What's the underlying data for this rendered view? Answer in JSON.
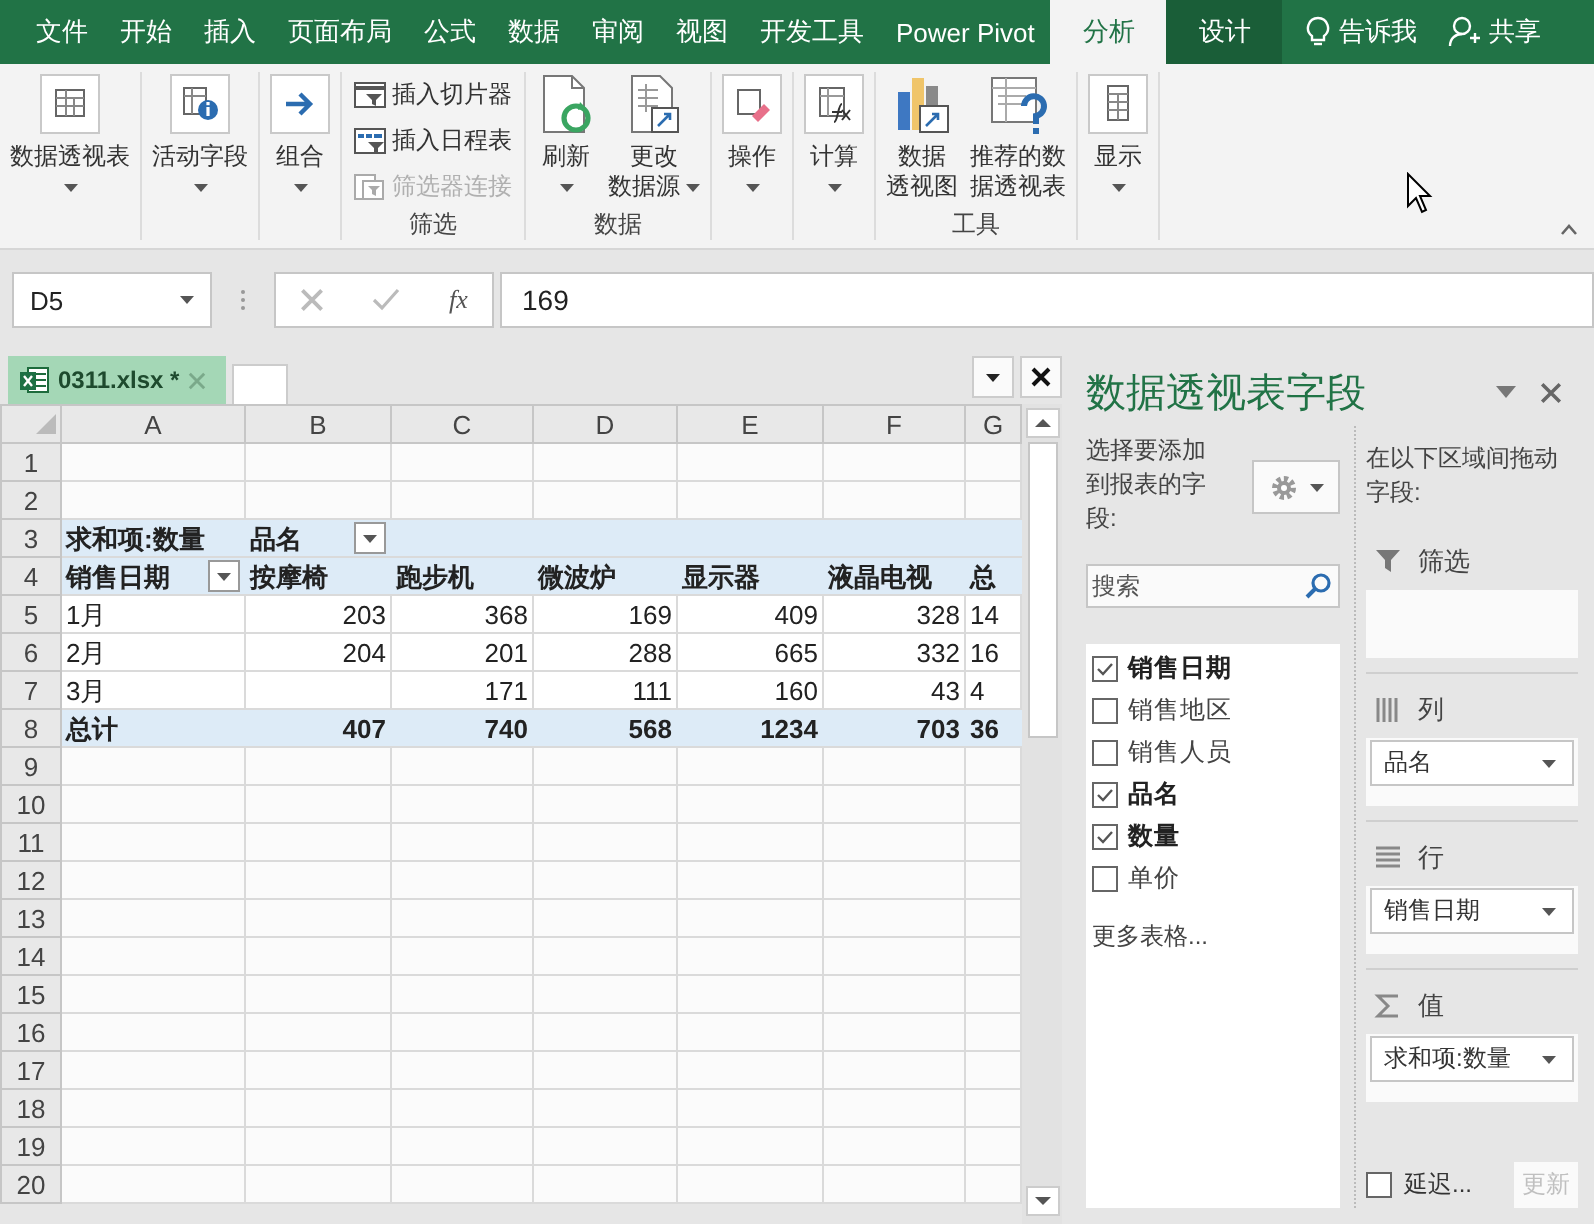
{
  "ribbon_tabs": [
    {
      "label": "文件",
      "selected": false,
      "kind": "normal"
    },
    {
      "label": "开始",
      "selected": false,
      "kind": "normal"
    },
    {
      "label": "插入",
      "selected": false,
      "kind": "normal"
    },
    {
      "label": "页面布局",
      "selected": false,
      "kind": "normal"
    },
    {
      "label": "公式",
      "selected": false,
      "kind": "normal"
    },
    {
      "label": "数据",
      "selected": false,
      "kind": "normal"
    },
    {
      "label": "审阅",
      "selected": false,
      "kind": "normal"
    },
    {
      "label": "视图",
      "selected": false,
      "kind": "normal"
    },
    {
      "label": "开发工具",
      "selected": false,
      "kind": "normal"
    },
    {
      "label": "Power Pivot",
      "selected": false,
      "kind": "normal"
    },
    {
      "label": "分析",
      "selected": true,
      "kind": "contextual"
    },
    {
      "label": "设计",
      "selected": false,
      "kind": "contextual"
    }
  ],
  "tell_me": "告诉我",
  "share": "共享",
  "ribbon_groups": [
    {
      "buttons": [
        {
          "label_lines": [
            "数据透视表"
          ],
          "kind": "large",
          "dropdown": true,
          "disabled": false
        }
      ]
    },
    {
      "buttons": [
        {
          "label_lines": [
            "活动字段"
          ],
          "kind": "large",
          "dropdown": true,
          "disabled": false
        }
      ]
    },
    {
      "buttons": [
        {
          "label_lines": [
            "组合"
          ],
          "kind": "large",
          "dropdown": true,
          "disabled": false
        }
      ]
    },
    {
      "label": "筛选",
      "buttons": [
        {
          "label_lines": [
            "插入切片器"
          ],
          "kind": "small",
          "dropdown": false,
          "disabled": false
        },
        {
          "label_lines": [
            "插入日程表"
          ],
          "kind": "small",
          "dropdown": false,
          "disabled": false
        },
        {
          "label_lines": [
            "筛选器连接"
          ],
          "kind": "small",
          "dropdown": false,
          "disabled": true
        }
      ]
    },
    {
      "label": "数据",
      "buttons": [
        {
          "label_lines": [
            "刷新"
          ],
          "kind": "large",
          "dropdown": true,
          "disabled": false
        },
        {
          "label_lines": [
            "更改",
            "数据源"
          ],
          "kind": "large",
          "dropdown": true,
          "disabled": false
        }
      ]
    },
    {
      "buttons": [
        {
          "label_lines": [
            "操作"
          ],
          "kind": "large",
          "dropdown": true,
          "disabled": false
        }
      ]
    },
    {
      "buttons": [
        {
          "label_lines": [
            "计算"
          ],
          "kind": "large",
          "dropdown": true,
          "disabled": false
        }
      ]
    },
    {
      "label": "工具",
      "buttons": [
        {
          "label_lines": [
            "数据",
            "透视图"
          ],
          "kind": "large",
          "dropdown": false,
          "disabled": false
        },
        {
          "label_lines": [
            "推荐的数",
            "据透视表"
          ],
          "kind": "large",
          "dropdown": false,
          "disabled": false
        }
      ]
    },
    {
      "buttons": [
        {
          "label_lines": [
            "显示"
          ],
          "kind": "large",
          "dropdown": true,
          "disabled": false
        }
      ]
    }
  ],
  "formula_bar": {
    "name_box": "D5",
    "function_label": "fx",
    "formula": "169"
  },
  "workbook_tab": {
    "title": "0311.xlsx *"
  },
  "sheet": {
    "columns": [
      "A",
      "B",
      "C",
      "D",
      "E",
      "F",
      "G"
    ],
    "rows": [
      {
        "number": "1",
        "kind": "empty"
      },
      {
        "number": "2",
        "kind": "empty"
      },
      {
        "number": "3",
        "kind": "pivot_header",
        "cells": [
          "求和项:数量",
          {
            "text": "品名",
            "filter_button": true
          }
        ]
      },
      {
        "number": "4",
        "kind": "pivot_header",
        "cells": [
          {
            "text": "销售日期",
            "filter_button": true
          },
          "按摩椅",
          "跑步机",
          "微波炉",
          "显示器",
          "液晶电视",
          "总"
        ]
      },
      {
        "number": "5",
        "kind": "data",
        "cells": [
          "1月",
          "203",
          "368",
          "169",
          "409",
          "328",
          "14"
        ]
      },
      {
        "number": "6",
        "kind": "data",
        "cells": [
          "2月",
          "204",
          "201",
          "288",
          "665",
          "332",
          "16"
        ]
      },
      {
        "number": "7",
        "kind": "data",
        "cells": [
          "3月",
          null,
          "171",
          "111",
          "160",
          "43",
          "4"
        ]
      },
      {
        "number": "8",
        "kind": "total",
        "cells": [
          "总计",
          "407",
          "740",
          "568",
          "1234",
          "703",
          "36"
        ]
      },
      {
        "number": "9",
        "kind": "empty"
      },
      {
        "number": "10",
        "kind": "empty"
      },
      {
        "number": "11",
        "kind": "empty"
      },
      {
        "number": "12",
        "kind": "empty"
      },
      {
        "number": "13",
        "kind": "empty"
      },
      {
        "number": "14",
        "kind": "empty"
      },
      {
        "number": "15",
        "kind": "empty"
      },
      {
        "number": "16",
        "kind": "empty"
      },
      {
        "number": "17",
        "kind": "empty"
      },
      {
        "number": "18",
        "kind": "empty"
      },
      {
        "number": "19",
        "kind": "empty"
      },
      {
        "number": "20",
        "kind": "empty"
      }
    ]
  },
  "field_pane": {
    "title": "数据透视表字段",
    "choose_prompt": "选择要添加到报表的字段:",
    "search_placeholder": "搜索",
    "fields": [
      {
        "label": "销售日期",
        "checked": true
      },
      {
        "label": "销售地区",
        "checked": false
      },
      {
        "label": "销售人员",
        "checked": false
      },
      {
        "label": "品名",
        "checked": true
      },
      {
        "label": "数量",
        "checked": true
      },
      {
        "label": "单价",
        "checked": false
      }
    ],
    "more_tables": "更多表格...",
    "drag_prompt": "在以下区域间拖动字段:",
    "areas": [
      {
        "kind": "filters",
        "label": "筛选"
      },
      {
        "kind": "columns",
        "label": "列",
        "items": [
          "品名"
        ]
      },
      {
        "kind": "rows",
        "label": "行",
        "items": [
          "销售日期"
        ]
      },
      {
        "kind": "values",
        "label": "值",
        "items": [
          "求和项:数量"
        ]
      }
    ],
    "defer": {
      "label": "延迟...",
      "checked": false
    },
    "update": {
      "label": "更新",
      "disabled": true
    }
  }
}
